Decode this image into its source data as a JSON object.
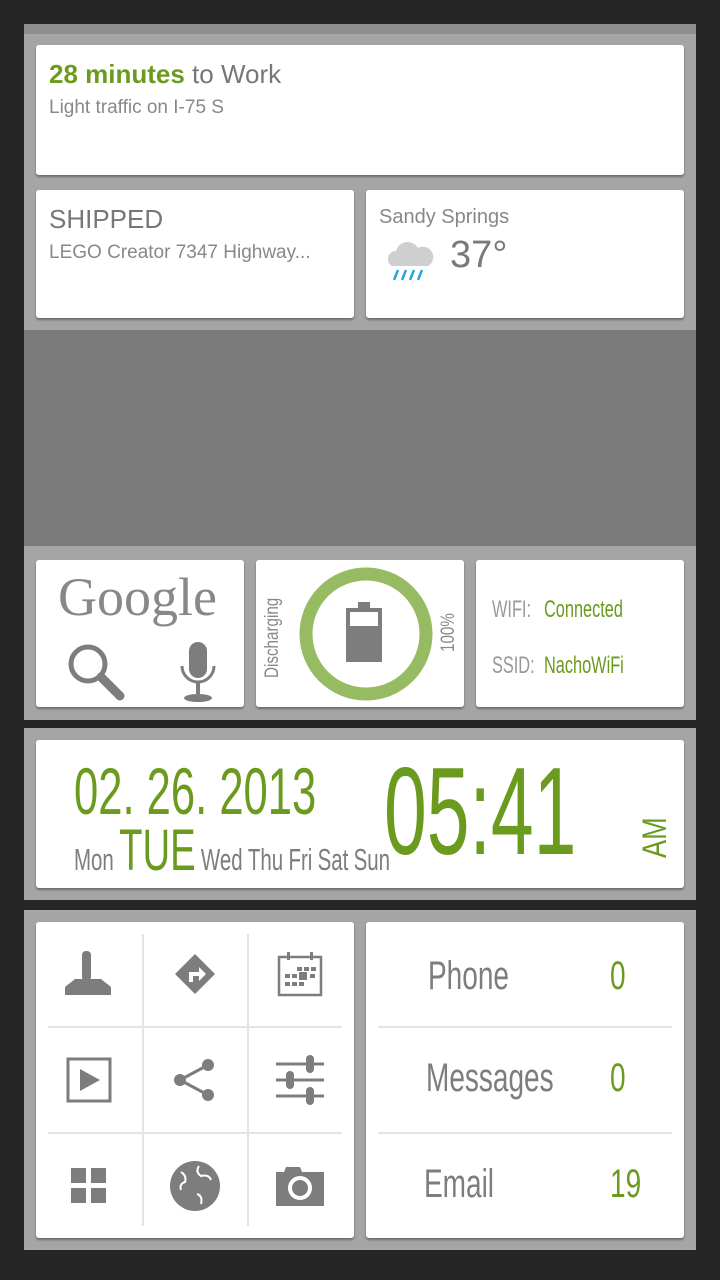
{
  "commute": {
    "minutes": "28 minutes",
    "destination": " to Work",
    "traffic": "Light traffic on I-75 S"
  },
  "package": {
    "status": "SHIPPED",
    "item": "LEGO Creator 7347 Highway..."
  },
  "weather": {
    "location": "Sandy Springs",
    "temp": "37°",
    "icon": "rain-cloud-icon"
  },
  "google": {
    "logo": "Google",
    "icons": [
      "search-icon",
      "microphone-icon"
    ]
  },
  "battery": {
    "status": "Discharging",
    "level_percent": 100,
    "level_label": "100%",
    "ring_color": "#97bb62"
  },
  "wifi": {
    "wifi_label": "WIFI:",
    "wifi_value": "Connected",
    "ssid_label": "SSID:",
    "ssid_value": "NachoWiFi"
  },
  "clock": {
    "date": "02. 26. 2013",
    "days": [
      "Mon",
      "TUE",
      "Wed",
      "Thu",
      "Fri",
      "Sat",
      "Sun"
    ],
    "active_day": "TUE",
    "time": "05:41",
    "ampm": "AM"
  },
  "shortcuts": [
    "joystick-icon",
    "directions-icon",
    "calendar-icon",
    "play-icon",
    "share-icon",
    "settings-sliders-icon",
    "apps-grid-icon",
    "globe-icon",
    "camera-icon"
  ],
  "counters": [
    {
      "label": "Phone",
      "count": "0"
    },
    {
      "label": "Messages",
      "count": "0"
    },
    {
      "label": "Email",
      "count": "19"
    }
  ],
  "colors": {
    "accent": "#6b9b1e",
    "icon": "#7d7d7d"
  }
}
